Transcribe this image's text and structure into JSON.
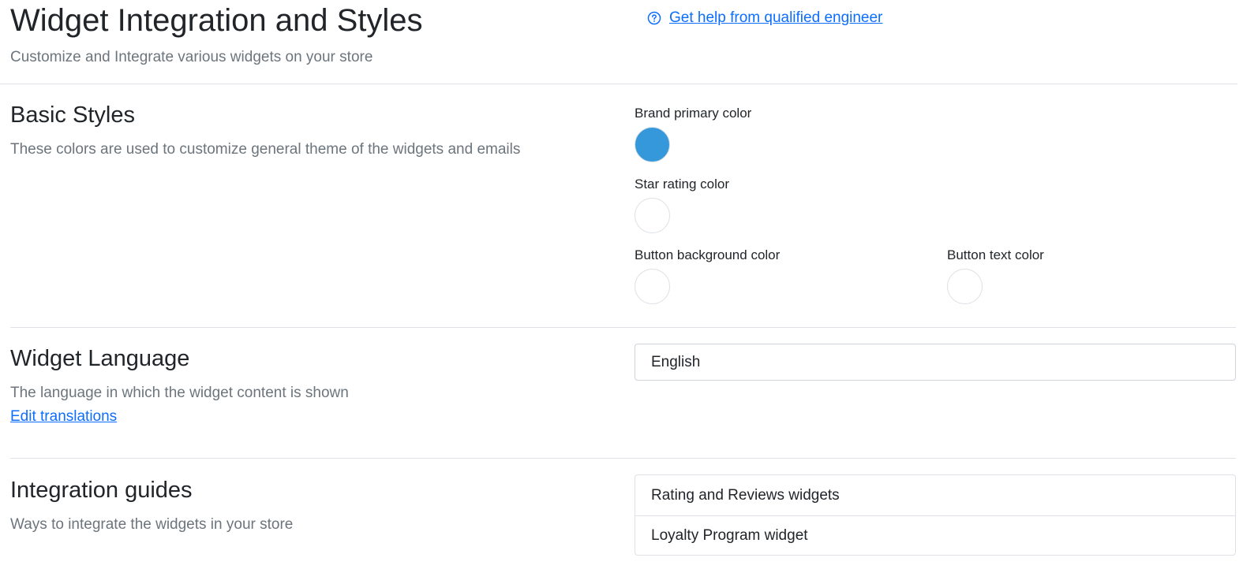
{
  "header": {
    "title": "Widget Integration and Styles",
    "subtitle": "Customize and Integrate various widgets on your store",
    "help_link": "Get help from qualified engineer",
    "help_icon": "question-circle-icon"
  },
  "basic_styles": {
    "title": "Basic Styles",
    "description": "These colors are used to customize general theme of the widgets and emails",
    "fields": [
      {
        "label": "Brand primary color",
        "color": "#3498db"
      },
      {
        "label": "Star rating color",
        "color": "#ffffff"
      },
      {
        "label": "Button background color",
        "color": "#ffffff"
      },
      {
        "label": "Button text color",
        "color": "#ffffff"
      }
    ]
  },
  "widget_language": {
    "title": "Widget Language",
    "description": "The language in which the widget content is shown",
    "edit_link": "Edit translations",
    "selected": "English"
  },
  "integration_guides": {
    "title": "Integration guides",
    "description": "Ways to integrate the widgets in your store",
    "items": [
      {
        "label": "Rating and Reviews widgets"
      },
      {
        "label": "Loyalty Program widget"
      }
    ]
  },
  "colors": {
    "link": "#0d6efd",
    "muted_text": "#6c757d",
    "border": "#dee2e6"
  }
}
